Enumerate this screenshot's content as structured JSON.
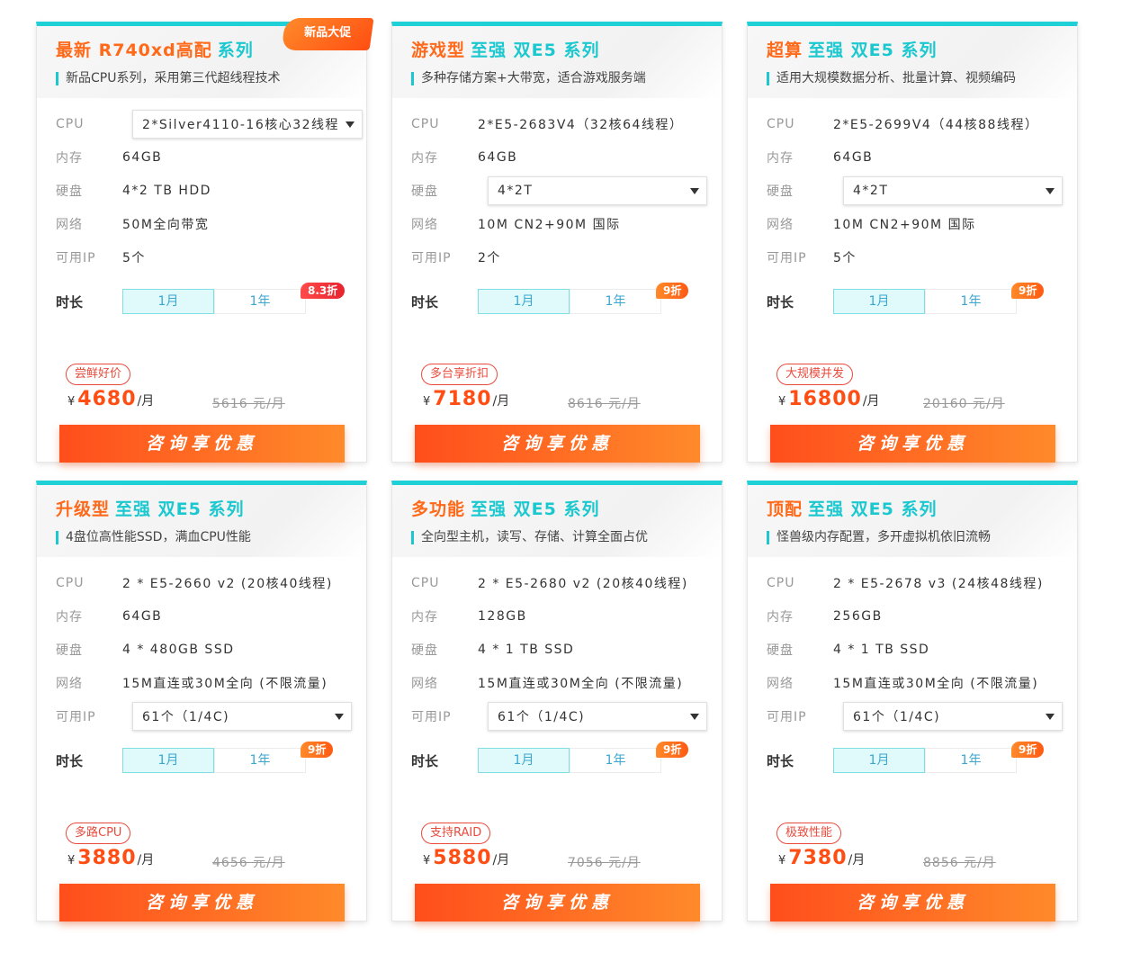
{
  "cards": [
    {
      "title_a": "最新 R740xd高配",
      "title_b": "系列",
      "ribbon": "新品大促",
      "subtitle": "新品CPU系列，采用第三代超线程技术",
      "cpu_label": "CPU",
      "cpu": "2*Silver4110-16核心32线程",
      "mem_label": "内存",
      "mem": "64GB",
      "disk_label": "硬盘",
      "disk": "4*2 TB HDD",
      "net_label": "网络",
      "net": "50M全向带宽",
      "ip_label": "可用IP",
      "ip": "5个",
      "dur_label": "时长",
      "opt_month": "1月",
      "opt_year": "1年",
      "discount": "8.3折",
      "tag": "尝鲜好价",
      "currency": "¥",
      "price": "4680",
      "unit": "/月",
      "orig": "5616 元/月",
      "button": "咨询享优惠"
    },
    {
      "title_a": "游戏型",
      "title_b": "至强 双E5 系列",
      "subtitle": "多种存储方案+大带宽，适合游戏服务端",
      "cpu_label": "CPU",
      "cpu": "2*E5-2683V4（32核64线程）",
      "mem_label": "内存",
      "mem": "64GB",
      "disk_label": "硬盘",
      "disk": "4*2T",
      "net_label": "网络",
      "net": "10M CN2+90M 国际",
      "ip_label": "可用IP",
      "ip": "2个",
      "dur_label": "时长",
      "opt_month": "1月",
      "opt_year": "1年",
      "discount": "9折",
      "tag": "多台享折扣",
      "currency": "¥",
      "price": "7180",
      "unit": "/月",
      "orig": "8616 元/月",
      "button": "咨询享优惠"
    },
    {
      "title_a": "超算",
      "title_b": "至强 双E5 系列",
      "subtitle": "适用大规模数据分析、批量计算、视频编码",
      "cpu_label": "CPU",
      "cpu": "2*E5-2699V4（44核88线程）",
      "mem_label": "内存",
      "mem": "64GB",
      "disk_label": "硬盘",
      "disk": "4*2T",
      "net_label": "网络",
      "net": "10M CN2+90M 国际",
      "ip_label": "可用IP",
      "ip": "5个",
      "dur_label": "时长",
      "opt_month": "1月",
      "opt_year": "1年",
      "discount": "9折",
      "tag": "大规模并发",
      "currency": "¥",
      "price": "16800",
      "unit": "/月",
      "orig": "20160 元/月",
      "button": "咨询享优惠"
    },
    {
      "title_a": "升级型",
      "title_b": "至强 双E5 系列",
      "subtitle": "4盘位高性能SSD，满血CPU性能",
      "cpu_label": "CPU",
      "cpu": "2 * E5-2660 v2 (20核40线程)",
      "mem_label": "内存",
      "mem": "64GB",
      "disk_label": "硬盘",
      "disk": "4 * 480GB SSD",
      "net_label": "网络",
      "net": "15M直连或30M全向 (不限流量)",
      "ip_label": "可用IP",
      "ip": "61个（1/4C)",
      "dur_label": "时长",
      "opt_month": "1月",
      "opt_year": "1年",
      "discount": "9折",
      "tag": "多路CPU",
      "currency": "¥",
      "price": "3880",
      "unit": "/月",
      "orig": "4656 元/月",
      "button": "咨询享优惠"
    },
    {
      "title_a": "多功能",
      "title_b": "至强 双E5 系列",
      "subtitle": "全向型主机，读写、存储、计算全面占优",
      "cpu_label": "CPU",
      "cpu": "2 * E5-2680 v2 (20核40线程)",
      "mem_label": "内存",
      "mem": "128GB",
      "disk_label": "硬盘",
      "disk": "4 * 1 TB SSD",
      "net_label": "网络",
      "net": "15M直连或30M全向 (不限流量)",
      "ip_label": "可用IP",
      "ip": "61个（1/4C)",
      "dur_label": "时长",
      "opt_month": "1月",
      "opt_year": "1年",
      "discount": "9折",
      "tag": "支持RAID",
      "currency": "¥",
      "price": "5880",
      "unit": "/月",
      "orig": "7056 元/月",
      "button": "咨询享优惠"
    },
    {
      "title_a": "顶配",
      "title_b": "至强 双E5 系列",
      "subtitle": "怪兽级内存配置，多开虚拟机依旧流畅",
      "cpu_label": "CPU",
      "cpu": "2 * E5-2678 v3 (24核48线程)",
      "mem_label": "内存",
      "mem": "256GB",
      "disk_label": "硬盘",
      "disk": "4 * 1 TB SSD",
      "net_label": "网络",
      "net": "15M直连或30M全向 (不限流量)",
      "ip_label": "可用IP",
      "ip": "61个（1/4C)",
      "dur_label": "时长",
      "opt_month": "1月",
      "opt_year": "1年",
      "discount": "9折",
      "tag": "极致性能",
      "currency": "¥",
      "price": "7380",
      "unit": "/月",
      "orig": "8856 元/月",
      "button": "咨询享优惠"
    }
  ],
  "colors": {
    "accent_teal": "#1cc8cf",
    "accent_orange": "#ff6a1a",
    "price_red": "#ff4e14"
  }
}
